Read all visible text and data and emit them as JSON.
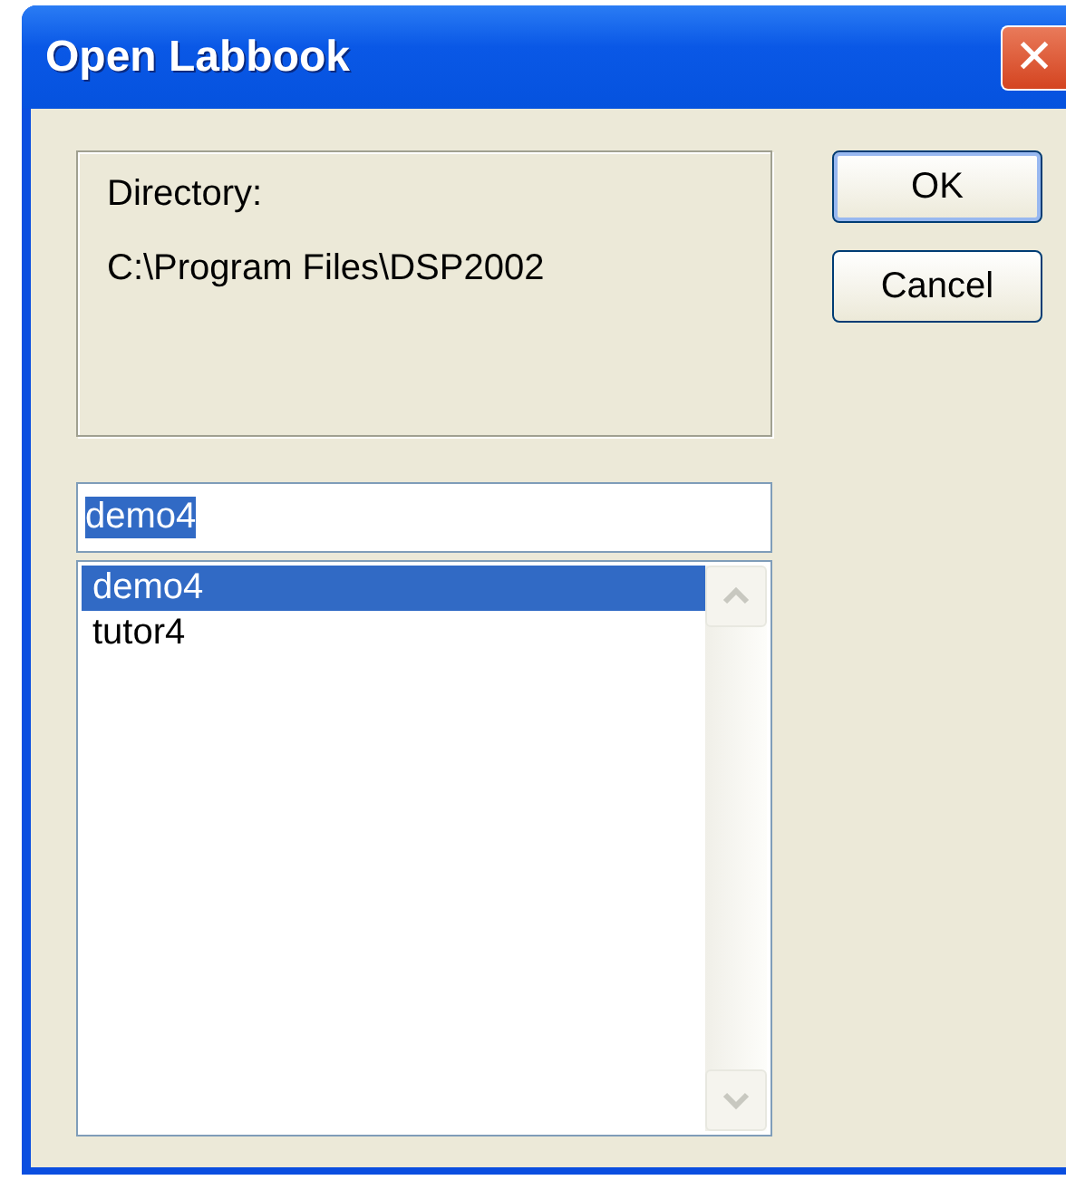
{
  "window": {
    "title": "Open Labbook",
    "close": "✕"
  },
  "directory": {
    "label": "Directory:",
    "path": "C:\\Program Files\\DSP2002"
  },
  "buttons": [
    {
      "label": "OK",
      "default": true
    },
    {
      "label": "Cancel",
      "default": false
    }
  ],
  "name_field": {
    "value": "demo4",
    "text_selected": true
  },
  "list": {
    "items": [
      {
        "label": "demo4",
        "selected": true
      },
      {
        "label": "tutor4",
        "selected": false
      }
    ]
  }
}
